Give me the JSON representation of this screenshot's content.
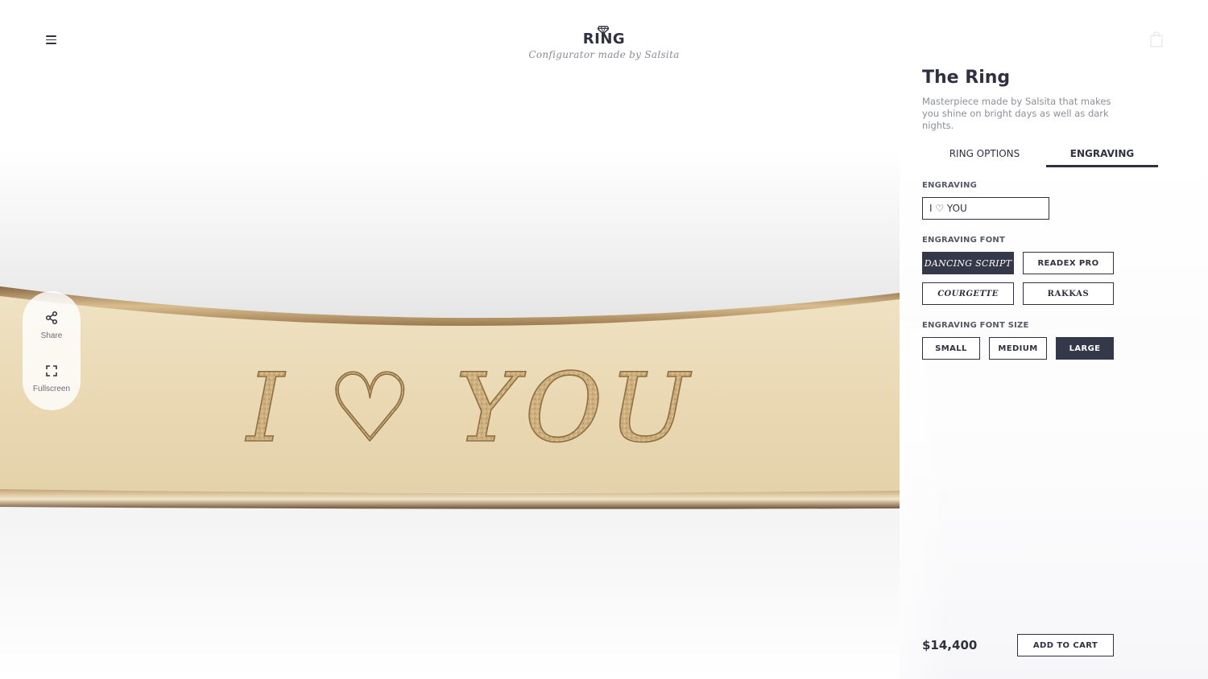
{
  "header": {
    "logo_word": "RING",
    "logo_tagline": "Configurator made by Salsita",
    "menu_icon": "hamburger-menu-icon",
    "cart_icon": "shopping-bag-icon"
  },
  "stage": {
    "engraving_preview": "I ♡ YOU",
    "band_color": "#e8d9b5",
    "rim_color": "#b38a5a"
  },
  "side_actions": [
    {
      "label": "Share",
      "icon": "share-icon"
    },
    {
      "label": "Fullscreen",
      "icon": "fullscreen-icon"
    }
  ],
  "product": {
    "title": "The Ring",
    "description": "Masterpiece made by Salsita that makes you shine on bright days as well as dark nights."
  },
  "tabs": [
    {
      "label": "RING OPTIONS",
      "active": false
    },
    {
      "label": "ENGRAVING",
      "active": true
    }
  ],
  "engraving": {
    "label": "ENGRAVING",
    "value": "I ♡ YOU"
  },
  "engraving_font": {
    "label": "ENGRAVING FONT",
    "options": [
      {
        "label": "DANCING SCRIPT",
        "selected": true
      },
      {
        "label": "READEX PRO",
        "selected": false
      },
      {
        "label": "COURGETTE",
        "selected": false
      },
      {
        "label": "RAKKAS",
        "selected": false
      }
    ]
  },
  "engraving_font_size": {
    "label": "ENGRAVING FONT SIZE",
    "options": [
      {
        "label": "SMALL",
        "selected": false
      },
      {
        "label": "MEDIUM",
        "selected": false
      },
      {
        "label": "LARGE",
        "selected": true
      }
    ]
  },
  "footer": {
    "price": "$14,400",
    "add_to_cart": "ADD TO CART"
  },
  "colors": {
    "primary_dark": "#353849",
    "text": "#2f3140",
    "muted": "#8d8f99"
  }
}
